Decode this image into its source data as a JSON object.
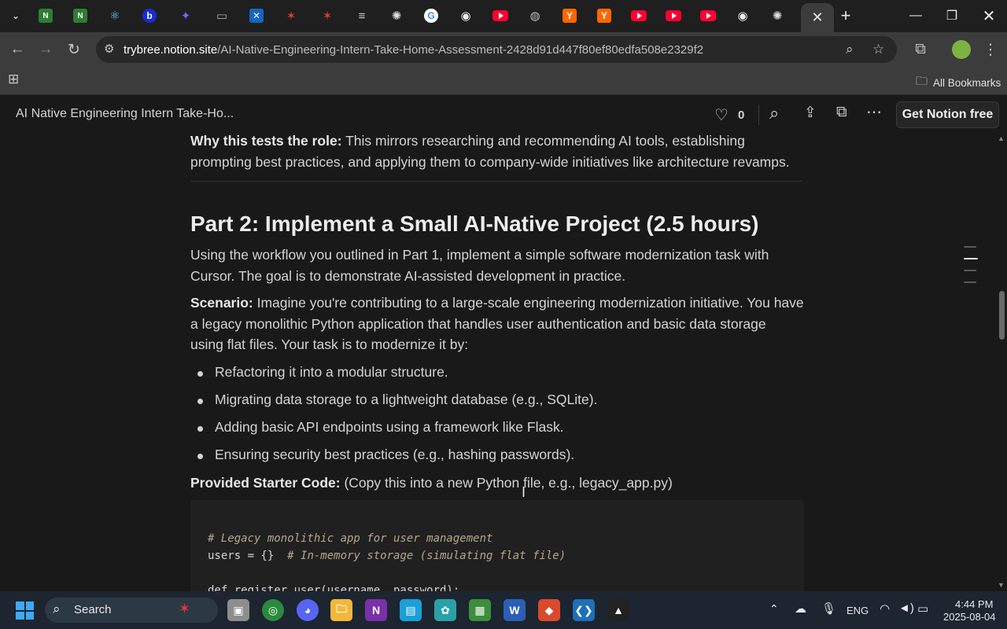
{
  "browser": {
    "active_tab_close": "✕",
    "new_tab": "+",
    "url_host": "trybree.notion.site",
    "url_path": "/AI-Native-Engineering-Intern-Take-Home-Assessment-2428d91d447f80ef80edfa508e2329f2",
    "bookmarks_label": "All Bookmarks",
    "tab_icons": [
      "notion-icon",
      "notion-icon",
      "react-icon",
      "b-icon",
      "brand-icon",
      "tab-icon",
      "x-icon",
      "maple-icon",
      "maple-icon",
      "docs-icon",
      "chatgpt-icon",
      "google-icon",
      "github-icon",
      "youtube-icon",
      "globe-icon",
      "ycombinator-icon",
      "ycombinator-icon",
      "youtube-icon",
      "youtube-icon",
      "youtube-icon",
      "github-icon",
      "chatgpt-icon"
    ]
  },
  "notion": {
    "page_title": "AI Native Engineering Intern Take-Ho...",
    "like_count": "0",
    "cta": "Get Notion free"
  },
  "doc": {
    "why_label": "Why this tests the role:",
    "why_text_1": " This mirrors researching and recommending AI tools, establishing",
    "why_text_2": "prompting best practices, and applying them to company-wide initiatives like architecture revamps.",
    "heading": "Part 2: Implement a Small AI-Native Project (2.5 hours)",
    "intro_1": "Using the workflow you outlined in Part 1, implement a simple software modernization task with",
    "intro_2": "Cursor. The goal is to demonstrate AI-assisted development in practice.",
    "scenario_label": "Scenario:",
    "scenario_1": " Imagine you're contributing to a large-scale engineering modernization initiative. You have",
    "scenario_2": "a legacy monolithic Python application that handles user authentication and basic data storage",
    "scenario_3": "using flat files. Your task is to modernize it by:",
    "bullets": [
      "Refactoring it into a modular structure.",
      "Migrating data storage to a lightweight database (e.g., SQLite).",
      "Adding basic API endpoints using a framework like Flask.",
      "Ensuring security best practices (e.g., hashing passwords)."
    ],
    "starter_label": "Provided Starter Code:",
    "starter_text": " (Copy this into a new Python file, e.g., legacy_app.py)",
    "code_line_1": "# Legacy monolithic app for user management",
    "code_line_2a": "users = {}  ",
    "code_line_2b": "# In-memory storage (simulating flat file)",
    "code_line_3": "def register_user(username, password):"
  },
  "taskbar": {
    "search_label": "Search",
    "lang": "ENG",
    "time": "4:44 PM",
    "date": "2025-08-04"
  },
  "colors": {
    "bg": "#191919",
    "chrome_toolbar": "#3c3c3c",
    "taskbar": "#1c2530"
  }
}
